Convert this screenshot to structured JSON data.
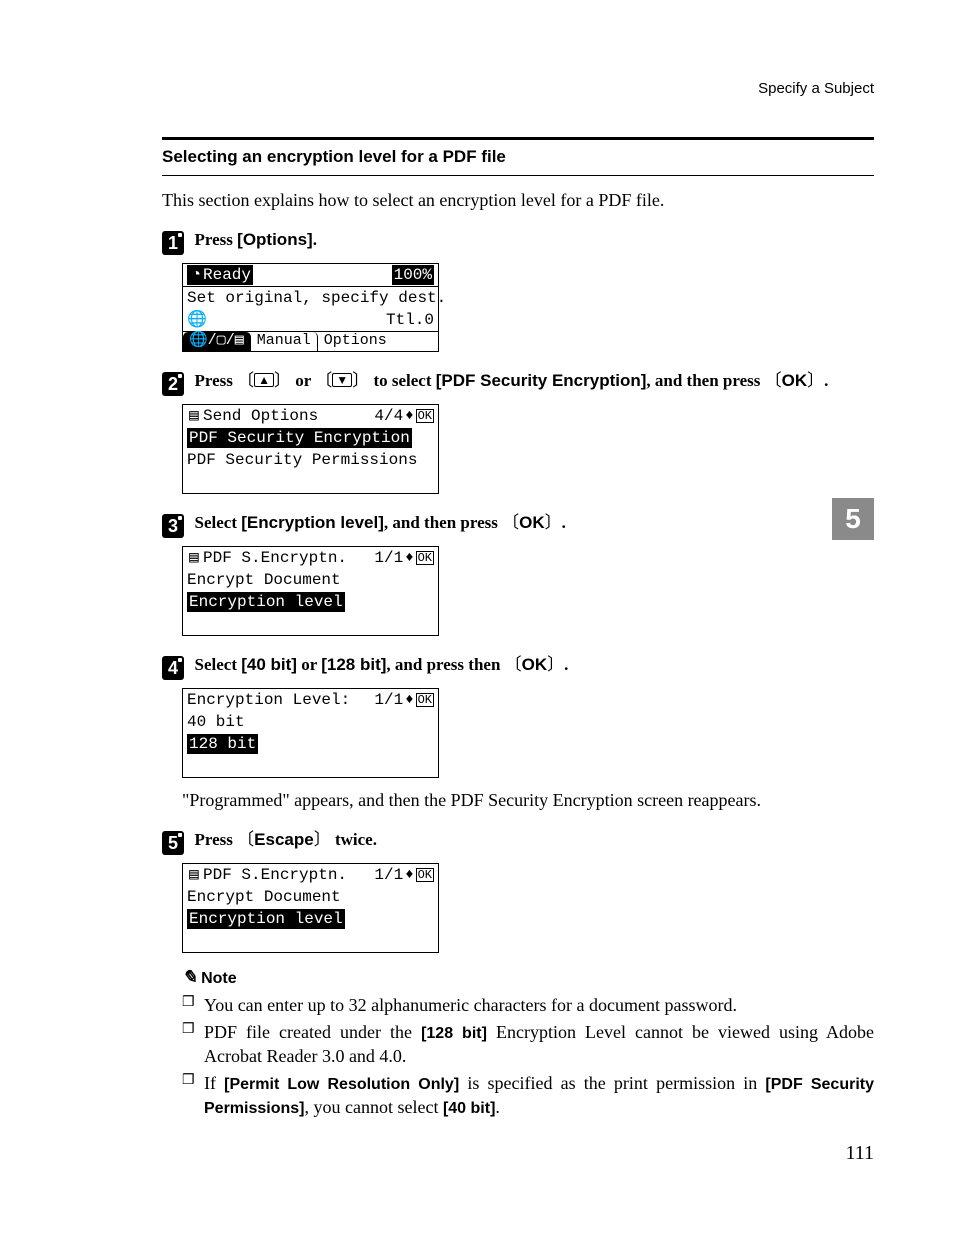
{
  "running_head": "Specify a Subject",
  "section_title": "Selecting an encryption level for a PDF file",
  "intro": "This section explains how to select an encryption level for a PDF file.",
  "side_tab": "5",
  "page_number": "111",
  "steps": {
    "s1": {
      "prefix": "Press ",
      "ui": "[Options]",
      "suffix": "."
    },
    "s2": {
      "prefix": "Press ",
      "key_up": "▲",
      "mid1": " or ",
      "key_down": "▼",
      "mid2": " to select ",
      "ui": "[PDF Security Encryption]",
      "mid3": ", and then press ",
      "key_ok": "OK",
      "suffix": "."
    },
    "s3": {
      "prefix": "Select ",
      "ui": "[Encryption level]",
      "mid": ", and then press ",
      "key_ok": "OK",
      "suffix": "."
    },
    "s4": {
      "prefix": "Select ",
      "ui1": "[40 bit]",
      "mid1": " or ",
      "ui2": "[128 bit]",
      "mid2": ", and press then ",
      "key_ok": "OK",
      "suffix": "."
    },
    "s4_post": "\"Programmed\" appears, and then the PDF Security Encryption screen reappears.",
    "s5": {
      "prefix": "Press ",
      "key": "Escape",
      "suffix": " twice."
    }
  },
  "lcd1": {
    "ready_label": "Ready",
    "ready_pct": "100%",
    "line2": "Set original, specify dest.",
    "ttl_label": "Ttl.0",
    "tab_icons": "",
    "tab_manual": "Manual",
    "tab_options": "Options"
  },
  "lcd2": {
    "title": "Send Options",
    "page": "4/4",
    "ok": "OK",
    "item_sel": "PDF Security Encryption",
    "item2": "PDF Security Permissions"
  },
  "lcd3": {
    "title": "PDF S.Encryptn.",
    "page": "1/1",
    "ok": "OK",
    "item1": "Encrypt Document",
    "item_sel": "Encryption level"
  },
  "lcd4": {
    "title": "Encryption Level:",
    "page": "1/1",
    "ok": "OK",
    "item1": "40 bit",
    "item_sel": "128 bit"
  },
  "lcd5": {
    "title": "PDF S.Encryptn.",
    "page": "1/1",
    "ok": "OK",
    "item1": "Encrypt Document",
    "item_sel": "Encryption level"
  },
  "note": {
    "heading": "Note",
    "n1": "You can enter up to 32 alphanumeric characters for a document password.",
    "n2a": "PDF file created under the ",
    "n2_ui": "[128 bit]",
    "n2b": " Encryption Level cannot be viewed using Adobe Acrobat Reader 3.0 and 4.0.",
    "n3a": "If ",
    "n3_ui1": "[Permit Low Resolution Only]",
    "n3b": " is specified as the print permission in ",
    "n3_ui2": "[PDF Security Permissions]",
    "n3c": ", you cannot select ",
    "n3_ui3": "[40 bit]",
    "n3d": "."
  }
}
